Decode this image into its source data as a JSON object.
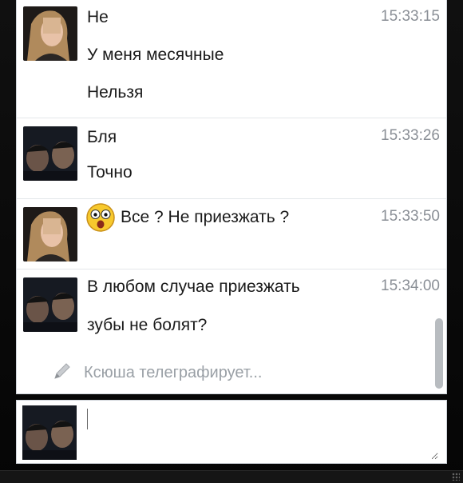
{
  "messages": [
    {
      "sender_avatar": "female-avatar",
      "time": "15:33:15",
      "lines": [
        "Не",
        "У меня месячные",
        "Нельзя"
      ]
    },
    {
      "sender_avatar": "male-pair-avatar",
      "time": "15:33:26",
      "lines": [
        "Бля",
        "Точно"
      ]
    },
    {
      "sender_avatar": "female-avatar",
      "time": "15:33:50",
      "emoji": "surprised-smiley-icon",
      "lines": [
        "Все ? Не приезжать ?"
      ]
    },
    {
      "sender_avatar": "male-pair-avatar",
      "time": "15:34:00",
      "lines": [
        "В любом случае приезжать",
        "зубы не болят?"
      ]
    }
  ],
  "typing_indicator": {
    "icon": "pencil-icon",
    "text": "Ксюша телеграфирует..."
  },
  "composer": {
    "avatar": "male-pair-avatar",
    "value": "",
    "placeholder": ""
  }
}
